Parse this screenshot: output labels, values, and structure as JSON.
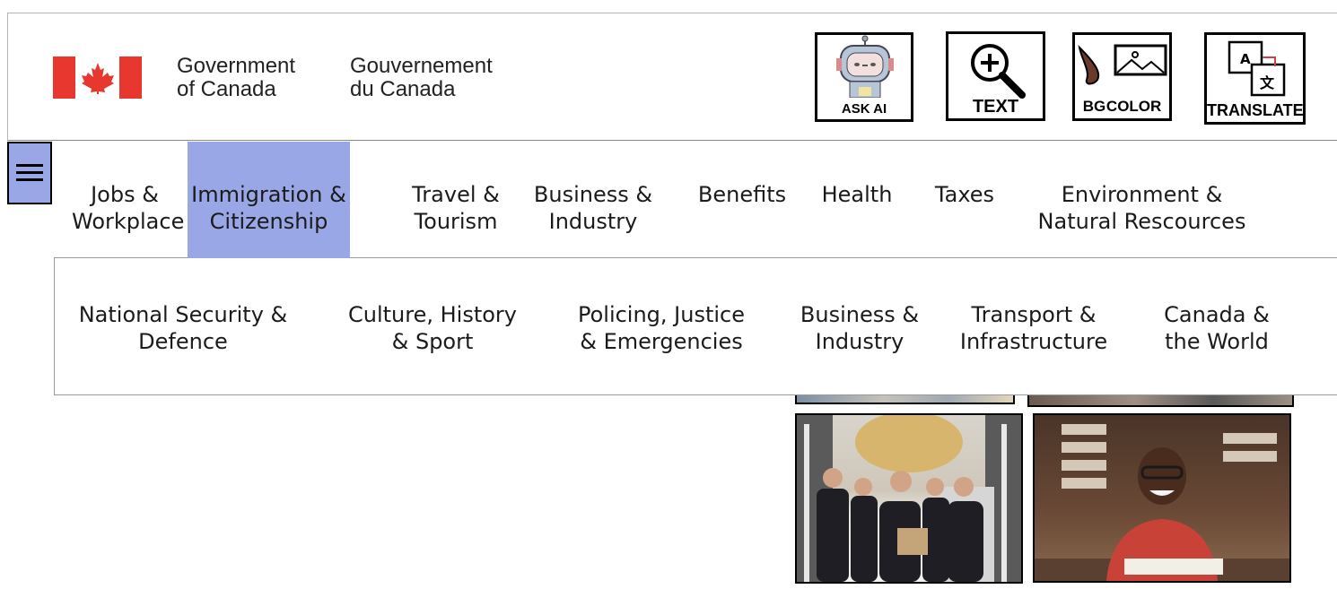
{
  "header": {
    "gov_en_line1": "Government",
    "gov_en_line2": "of Canada",
    "gov_fr_line1": "Gouvernement",
    "gov_fr_line2": "du Canada",
    "flag_icon": "canada-flag-icon",
    "tools": [
      {
        "label": "ASK AI",
        "icon": "robot-icon"
      },
      {
        "label": "TEXT",
        "icon": "magnify-plus-icon"
      },
      {
        "label": "BG COLOR",
        "icon": "paint-image-icon"
      },
      {
        "label": "TRANSLATE",
        "icon": "translate-icon"
      }
    ]
  },
  "menu": {
    "toggle_icon": "hamburger-icon",
    "row1": [
      {
        "l1": "Jobs &",
        "l2": "Workplace"
      },
      {
        "l1": "Immigration &",
        "l2": "Citizenship"
      },
      {
        "l1": "Travel &",
        "l2": "Tourism"
      },
      {
        "l1": "Business &",
        "l2": "Industry"
      },
      {
        "l1": "Benefits",
        "l2": ""
      },
      {
        "l1": "Health",
        "l2": ""
      },
      {
        "l1": "Taxes",
        "l2": ""
      },
      {
        "l1": "Environment &",
        "l2": "Natural Rescources"
      }
    ],
    "row2": [
      {
        "l1": "National Security &",
        "l2": "Defence"
      },
      {
        "l1": "Culture, History",
        "l2": "& Sport"
      },
      {
        "l1": "Policing, Justice",
        "l2": "& Emergencies"
      },
      {
        "l1": "Business &",
        "l2": "Industry"
      },
      {
        "l1": "Transport &",
        "l2": "Infrastructure"
      },
      {
        "l1": "Canada &",
        "l2": "the World"
      }
    ]
  },
  "colors": {
    "flag_red": "#e8372e",
    "highlight": "#9aa7e6"
  }
}
